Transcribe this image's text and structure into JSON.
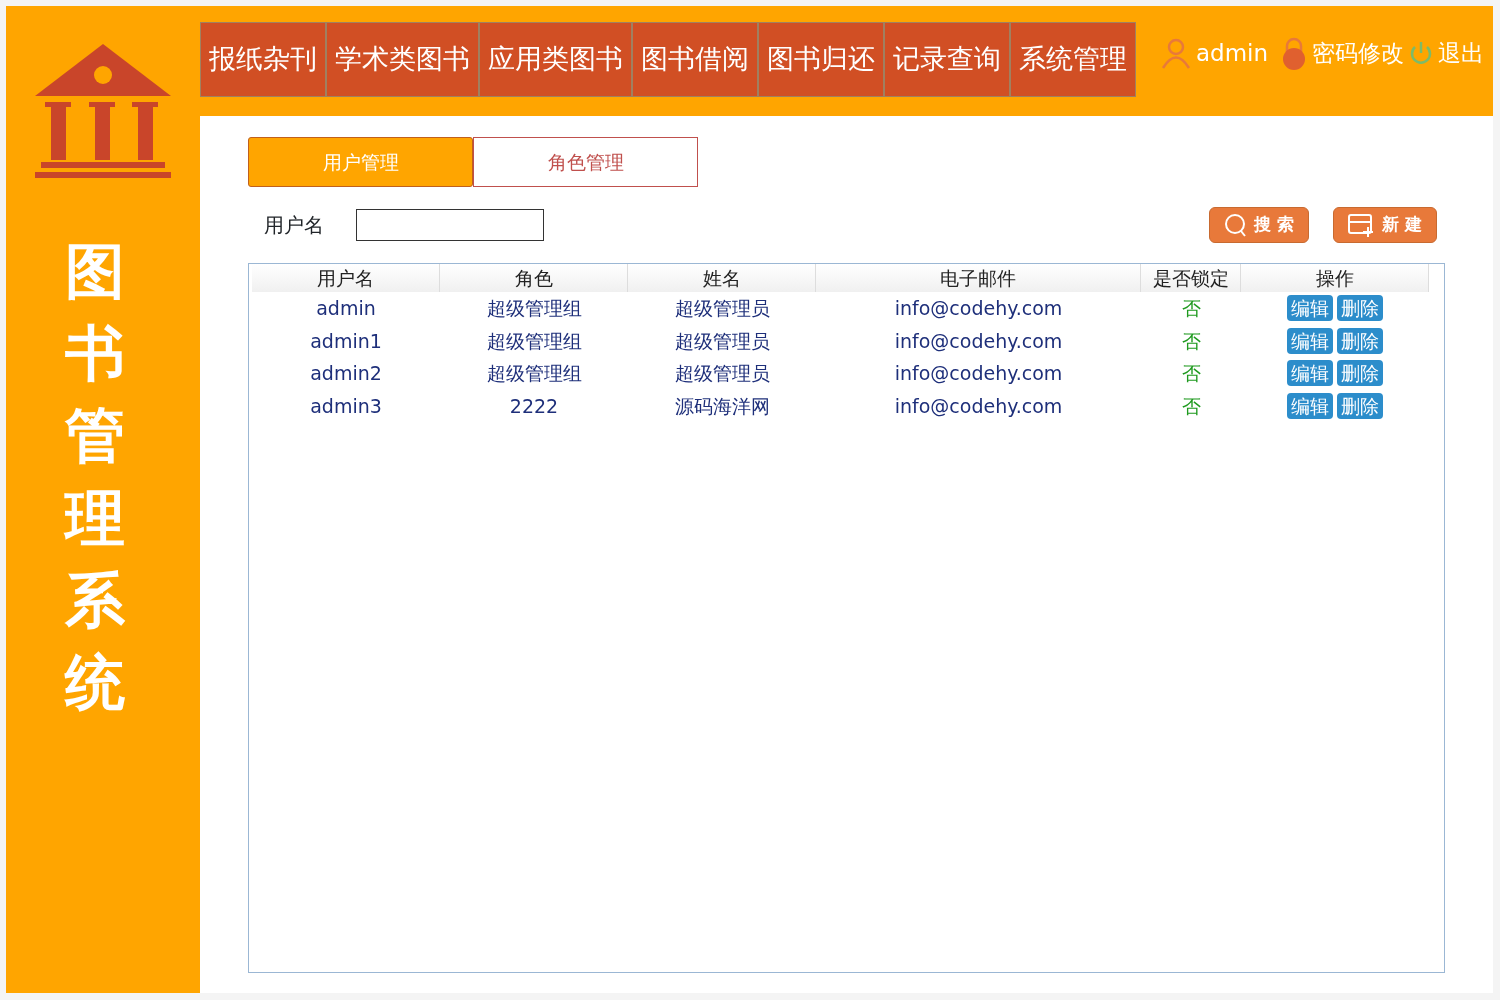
{
  "sidebar": {
    "title": "图书管理系统"
  },
  "menu": [
    {
      "label": "报纸杂刊"
    },
    {
      "label": "学术类图书"
    },
    {
      "label": "应用类图书"
    },
    {
      "label": "图书借阅"
    },
    {
      "label": "图书归还"
    },
    {
      "label": "记录查询"
    },
    {
      "label": "系统管理"
    }
  ],
  "user": {
    "name": "admin",
    "change_password": "密码修改",
    "logout": "退出"
  },
  "tabs": [
    {
      "label": "用户管理",
      "selected": true
    },
    {
      "label": "角色管理",
      "selected": false
    }
  ],
  "search": {
    "label": "用户名",
    "search_button": "搜 索",
    "new_button": "新 建"
  },
  "table": {
    "columns": [
      "用户名",
      "角色",
      "姓名",
      "电子邮件",
      "是否锁定",
      "操作"
    ],
    "rows": [
      {
        "username": "admin",
        "role": "超级管理组",
        "name": "超级管理员",
        "email": "info@codehy.com",
        "locked_text": "否",
        "locked": false,
        "edit": "编辑",
        "delete": "删除"
      },
      {
        "username": "admin1",
        "role": "超级管理组",
        "name": "超级管理员",
        "email": "info@codehy.com",
        "locked_text": "否",
        "locked": false,
        "edit": "编辑",
        "delete": "删除"
      },
      {
        "username": "admin2",
        "role": "超级管理组",
        "name": "超级管理员",
        "email": "info@codehy.com",
        "locked_text": "否",
        "locked": false,
        "edit": "编辑",
        "delete": "删除"
      },
      {
        "username": "admin3",
        "role": "2222",
        "name": "源码海洋网",
        "email": "info@codehy.com",
        "locked_text": "否",
        "locked": false,
        "edit": "编辑",
        "delete": "删除"
      }
    ]
  }
}
